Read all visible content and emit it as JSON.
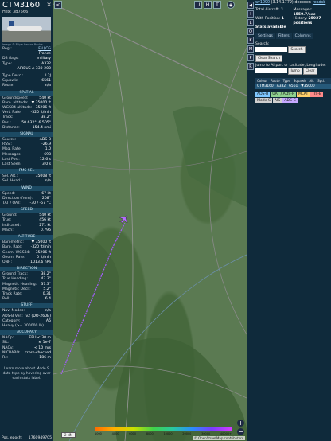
{
  "aircraft": {
    "callsign": "CTM3160",
    "hex_label": "Hex:",
    "hex": "3B7566",
    "photo_credit": "Image © Filipe Santos Rocha",
    "reg": {
      "label": "Reg.:",
      "value": "F-UJCG"
    },
    "country": "France",
    "db_flags": {
      "label": "DB flags:",
      "value": "military"
    },
    "type": {
      "label": "Type:",
      "value": "A332"
    },
    "type_full": "AIRBUS A-330-200",
    "type_desc": {
      "label": "Type Desc.:",
      "value": "L2J"
    },
    "squawk": {
      "label": "Squawk:",
      "value": "6561"
    },
    "route": {
      "label": "Route:",
      "value": "n/a"
    }
  },
  "sections": {
    "spatial": "SPATIAL",
    "signal": "SIGNAL",
    "fms": "FMS SEL",
    "wind": "WIND",
    "speed": "SPEED",
    "altitude": "ALTITUDE",
    "direction": "DIRECTION",
    "stuff": "STUFF",
    "accuracy": "ACCURACY"
  },
  "spatial": [
    {
      "k": "Groundspeed:",
      "v": "540 kt"
    },
    {
      "k": "Baro. altitude:",
      "v": "▼ 35000 ft"
    },
    {
      "k": "WGS84 altitude:",
      "v": "35206 ft"
    },
    {
      "k": "Vert. Rate:",
      "v": "-320 ft/min"
    },
    {
      "k": "Track:",
      "v": "38.2°"
    },
    {
      "k": "Pos.:",
      "v": "50.632°, 6.505°"
    },
    {
      "k": "Distance:",
      "v": "154.4 nmi"
    }
  ],
  "signal": [
    {
      "k": "Source:",
      "v": "ADS-B"
    },
    {
      "k": "RSSI:",
      "v": "-26.9"
    },
    {
      "k": "Msg. Rate:",
      "v": "1.0"
    },
    {
      "k": "Messages:",
      "v": "698"
    },
    {
      "k": "Last Pos.:",
      "v": "12.6 s"
    },
    {
      "k": "Last Seen:",
      "v": "3.0 s"
    }
  ],
  "fms": [
    {
      "k": "Sel. Alt.:",
      "v": "35008 ft"
    },
    {
      "k": "Sel. Head.:",
      "v": "n/a"
    }
  ],
  "wind": [
    {
      "k": "Speed:",
      "v": "67 kt"
    },
    {
      "k": "Direction (from):",
      "v": "208°"
    },
    {
      "k": "TAT / OAT:",
      "v": "-30 / -57 °C"
    }
  ],
  "speed": [
    {
      "k": "Ground:",
      "v": "540 kt"
    },
    {
      "k": "True:",
      "v": "456 kt"
    },
    {
      "k": "Indicated:",
      "v": "271 kt"
    },
    {
      "k": "Mach:",
      "v": "0.796"
    }
  ],
  "altitude": [
    {
      "k": "Barometric:",
      "v": "▼ 35000 ft"
    },
    {
      "k": "Baro. Rate:",
      "v": "-320 ft/min"
    },
    {
      "k": "Geom. WGS84:",
      "v": "35206 ft"
    },
    {
      "k": "Geom. Rate:",
      "v": "0 ft/min"
    },
    {
      "k": "QNH:",
      "v": "1013.6 hPa"
    }
  ],
  "direction": [
    {
      "k": "Ground Track:",
      "v": "38.2°"
    },
    {
      "k": "True Heading:",
      "v": "43.3°"
    },
    {
      "k": "Magnetic Heading:",
      "v": "37.3°"
    },
    {
      "k": "Magnetic Decl.:",
      "v": "5.2°"
    },
    {
      "k": "Track Rate:",
      "v": "0.31"
    },
    {
      "k": "Roll:",
      "v": "6.4"
    }
  ],
  "stuff": [
    {
      "k": "Nav. Modes:",
      "v": "n/a"
    },
    {
      "k": "ADS-B Ver.:",
      "v": "v2 (DO-260B)"
    },
    {
      "k": "Category:",
      "v": "A5"
    }
  ],
  "stuff_category_desc": "Heavy (>= 300000 lb)",
  "accuracy": [
    {
      "k": "NACp:",
      "v": "EPU < 30 m"
    },
    {
      "k": "SIL:",
      "v": "≤ 1e-7"
    },
    {
      "k": "NACv:",
      "v": "< 10 m/s"
    },
    {
      "k": "NICBARO:",
      "v": "cross-checked"
    },
    {
      "k": "Rc:",
      "v": "186 m"
    }
  ],
  "footer_text": "Learn more about Mode S data type by hovering over each stats label.",
  "epoch": {
    "k": "Pos. epoch:",
    "v": "1760949705"
  },
  "map": {
    "top_buttons": [
      "U",
      "H",
      "T"
    ],
    "left_buttons": [
      "<",
      ">"
    ],
    "scale": "2 NM",
    "colorbar_labels": [
      "1000",
      "4000",
      "6000",
      "8000",
      "10000",
      "20000",
      "30000",
      "40000+"
    ],
    "attribution": "© OpenStreetMap contributors",
    "zoom_in": "+",
    "zoom_out": "−"
  },
  "right_buttons": [
    "◀",
    "I",
    "L",
    "O",
    "K",
    "M",
    "P",
    "R"
  ],
  "right": {
    "link": "wr1090",
    "version": "(3.14.1779) decoder:",
    "decoder": "readsb",
    "stats": {
      "total_label": "Total Aircraft:",
      "total": "1",
      "messages_label": "Messages:",
      "messages": "1559.7/sec",
      "withpos_label": "With Position:",
      "withpos": "1",
      "history_label": "History:",
      "history": "25927 positions",
      "stats_available": "Stats available"
    },
    "tabs": [
      "Settings",
      "Filters",
      "Columns"
    ],
    "search_label": "Search:",
    "search_button": "Search",
    "clear_search": "Clear Search",
    "jump_label": "Jump to Airport or Latitude, Longitude:",
    "jump_button": "Jump",
    "clear_button": "Clear",
    "columns": [
      "Colour",
      "Route",
      "Type",
      "Squawk",
      "Alt.",
      "Spd."
    ],
    "table_row": {
      "callsign": "CTM3160",
      "type": "A332",
      "squawk": "6561",
      "alt": "▼35000"
    },
    "badges": [
      {
        "text": "ADS-B",
        "color": "#7ec8ff"
      },
      {
        "text": "UAT / ADS-R",
        "color": "#8fd18f"
      },
      {
        "text": "MLAT",
        "color": "#ffcf6a"
      },
      {
        "text": "TIS-B",
        "color": "#ff8a8a"
      },
      {
        "text": "Mode S",
        "color": "#d0d0d0"
      },
      {
        "text": "AIS",
        "color": "#d0d0d0"
      },
      {
        "text": "ADS-C",
        "color": "#c6a8ff"
      }
    ]
  }
}
